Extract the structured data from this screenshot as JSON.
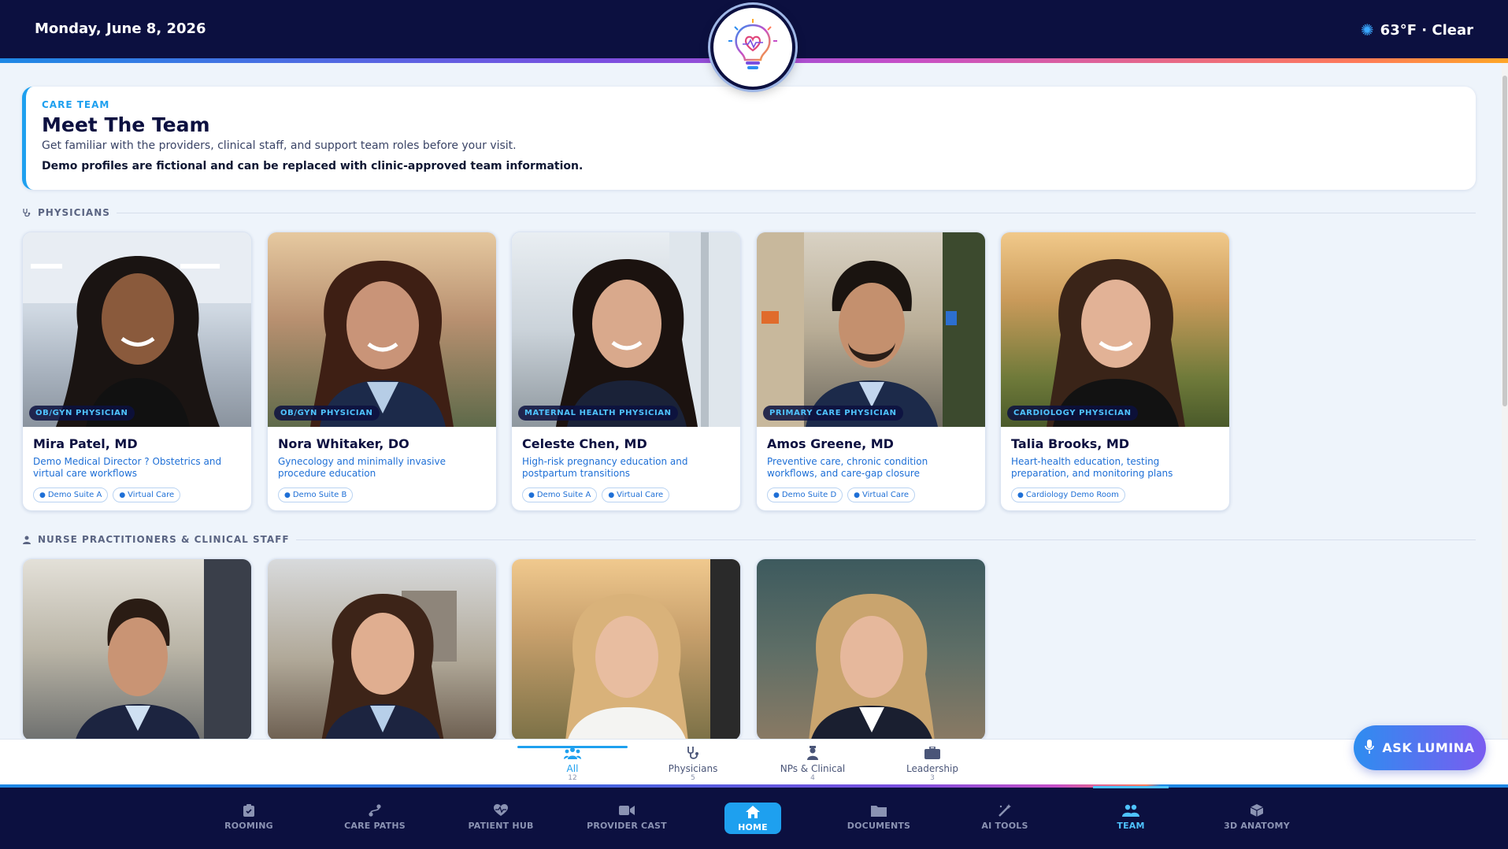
{
  "header": {
    "date": "Monday, June 8, 2026",
    "weather": "63°F · Clear",
    "weather_icon": "sun-icon",
    "logo_icon": "lightbulb-heart-logo"
  },
  "intro": {
    "eyebrow": "CARE TEAM",
    "title": "Meet The Team",
    "subtitle": "Get familiar with the providers, clinical staff, and support team roles before your visit.",
    "note": "Demo profiles are fictional and can be replaced with clinic-approved team information."
  },
  "sections": {
    "physicians": "PHYSICIANS",
    "nps": "NURSE PRACTITIONERS & CLINICAL STAFF"
  },
  "physicians": [
    {
      "role": "OB/GYN PHYSICIAN",
      "name": "Mira Patel, MD",
      "desc": "Demo Medical Director ? Obstetrics and virtual care workflows",
      "tags": [
        "Demo Suite A",
        "Virtual Care"
      ]
    },
    {
      "role": "OB/GYN PHYSICIAN",
      "name": "Nora Whitaker, DO",
      "desc": "Gynecology and minimally invasive procedure education",
      "tags": [
        "Demo Suite B"
      ]
    },
    {
      "role": "MATERNAL HEALTH PHYSICIAN",
      "name": "Celeste Chen, MD",
      "desc": "High-risk pregnancy education and postpartum transitions",
      "tags": [
        "Demo Suite A",
        "Virtual Care"
      ]
    },
    {
      "role": "PRIMARY CARE PHYSICIAN",
      "name": "Amos Greene, MD",
      "desc": "Preventive care, chronic condition workflows, and care-gap closure",
      "tags": [
        "Demo Suite D",
        "Virtual Care"
      ]
    },
    {
      "role": "CARDIOLOGY PHYSICIAN",
      "name": "Talia Brooks, MD",
      "desc": "Heart-health education, testing preparation, and monitoring plans",
      "tags": [
        "Cardiology Demo Room"
      ]
    }
  ],
  "filters": [
    {
      "label": "All",
      "count": "12",
      "icon": "group-icon"
    },
    {
      "label": "Physicians",
      "count": "5",
      "icon": "stethoscope-icon"
    },
    {
      "label": "NPs & Clinical",
      "count": "4",
      "icon": "nurse-icon"
    },
    {
      "label": "Leadership",
      "count": "3",
      "icon": "briefcase-icon"
    }
  ],
  "ask_button": "ASK LUMINA",
  "nav": [
    {
      "label": "ROOMING",
      "icon": "clipboard-icon"
    },
    {
      "label": "CARE PATHS",
      "icon": "route-icon"
    },
    {
      "label": "PATIENT HUB",
      "icon": "heart-pulse-icon"
    },
    {
      "label": "PROVIDER CAST",
      "icon": "video-icon"
    },
    {
      "label": "HOME",
      "icon": "home-icon"
    },
    {
      "label": "DOCUMENTS",
      "icon": "folder-icon"
    },
    {
      "label": "AI TOOLS",
      "icon": "magic-wand-icon"
    },
    {
      "label": "TEAM",
      "icon": "team-icon"
    },
    {
      "label": "3D ANATOMY",
      "icon": "cube-icon"
    }
  ],
  "colors": {
    "navy": "#0c1040",
    "accent": "#1ea0ef",
    "link": "#1e6fd6",
    "background": "#eef4fb"
  }
}
